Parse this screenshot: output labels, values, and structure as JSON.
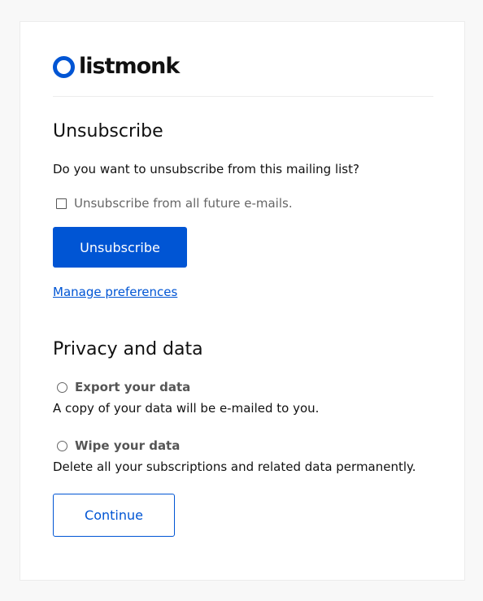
{
  "brand": {
    "name": "listmonk",
    "accent": "#0055d4"
  },
  "unsubscribe": {
    "title": "Unsubscribe",
    "question": "Do you want to unsubscribe from this mailing list?",
    "checkbox_label": "Unsubscribe from all future e-mails.",
    "checkbox_checked": false,
    "button_label": "Unsubscribe",
    "manage_link": "Manage preferences"
  },
  "privacy": {
    "title": "Privacy and data",
    "options": [
      {
        "label": "Export your data",
        "description": "A copy of your data will be e-mailed to you.",
        "selected": false
      },
      {
        "label": "Wipe your data",
        "description": "Delete all your subscriptions and related data permanently.",
        "selected": false
      }
    ],
    "continue_label": "Continue"
  }
}
